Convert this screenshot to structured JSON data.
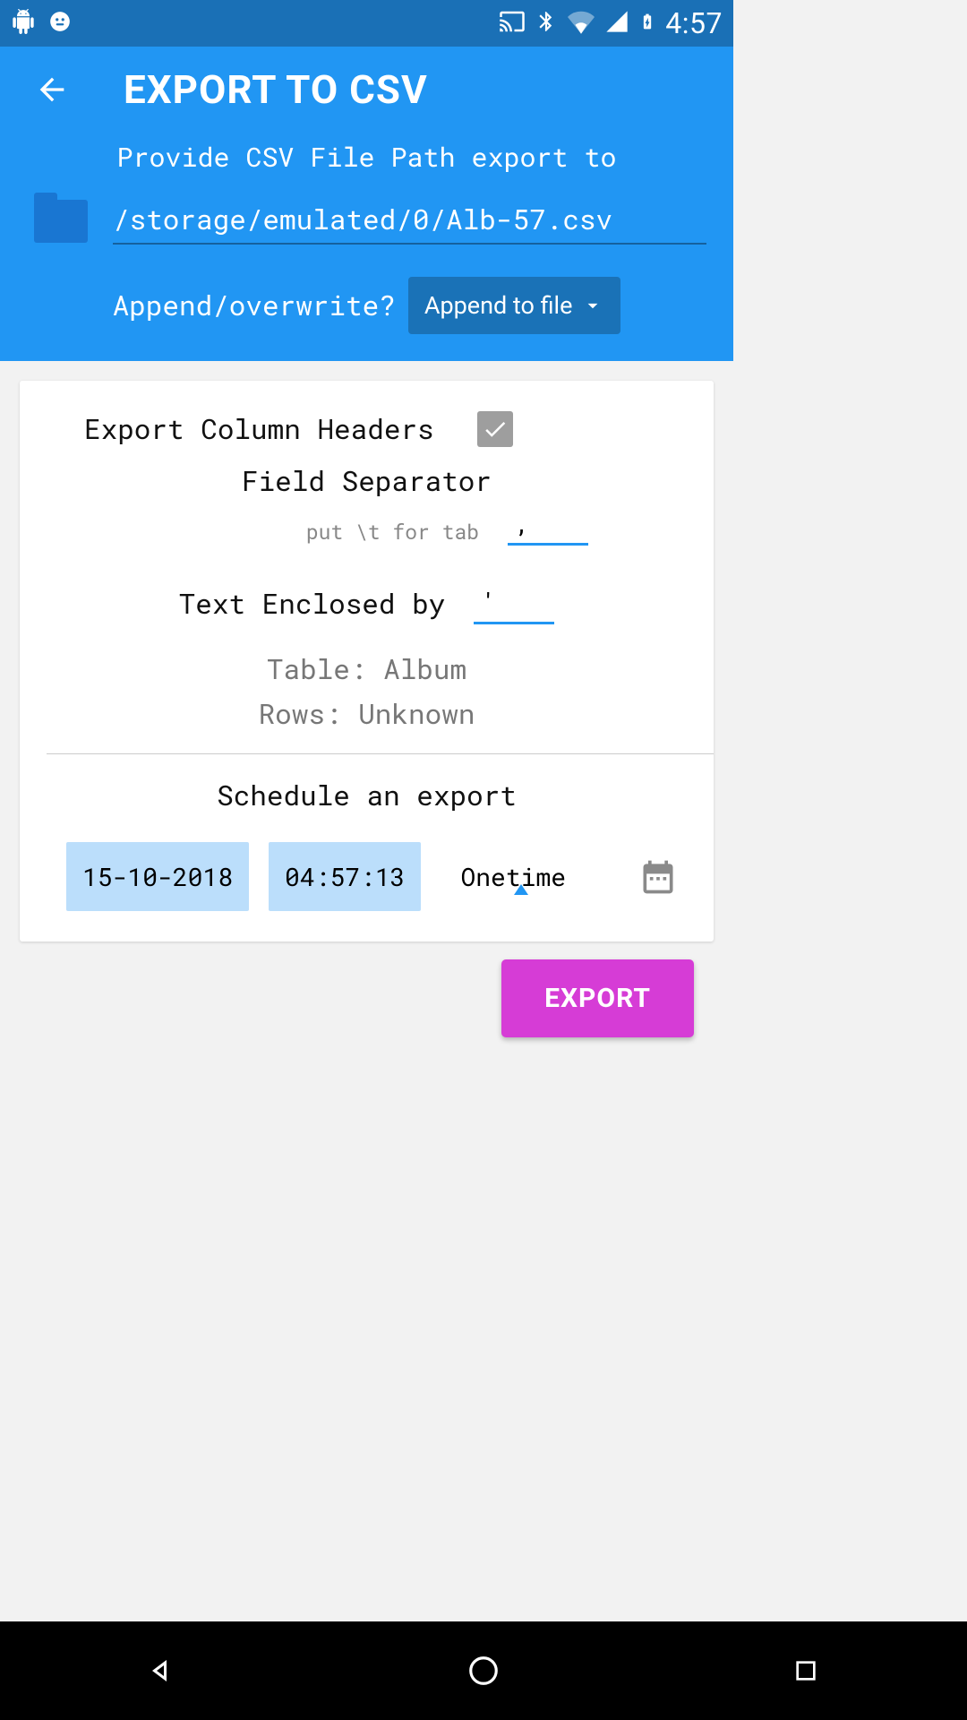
{
  "status": {
    "time": "4:57"
  },
  "header": {
    "title": "EXPORT TO CSV",
    "subtitle": "Provide CSV File Path export to",
    "path": "/storage/emulated/0/Alb-57.csv",
    "append_label": "Append/overwrite?",
    "append_value": "Append to file"
  },
  "form": {
    "headers_label": "Export Column Headers",
    "headers_checked": true,
    "sep_label": "Field Separator",
    "sep_hint": "put \\t for tab",
    "sep_value": ",",
    "enc_label": "Text Enclosed by",
    "enc_value": "'",
    "table_label": "Table: Album",
    "rows_label": "Rows: Unknown",
    "schedule_label": "Schedule an export",
    "date": "15-10-2018",
    "time": "04:57:13",
    "recurrence": "Onetime"
  },
  "actions": {
    "export": "EXPORT"
  }
}
